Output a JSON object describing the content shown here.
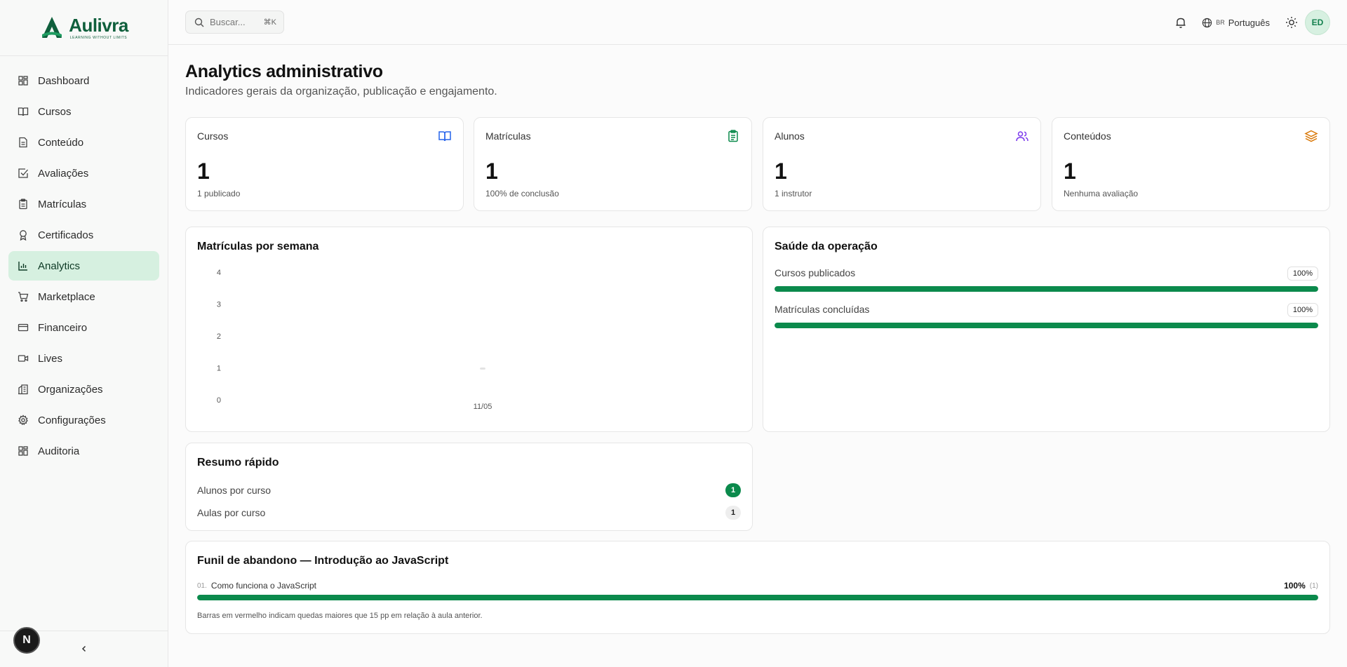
{
  "brand": {
    "name": "Aulivra",
    "tagline": "LEARNING WITHOUT LIMITS",
    "color": "#0f5f3c"
  },
  "sidebar": {
    "items": [
      {
        "label": "Dashboard",
        "icon": "grid-icon"
      },
      {
        "label": "Cursos",
        "icon": "book-open-icon"
      },
      {
        "label": "Conteúdo",
        "icon": "file-text-icon"
      },
      {
        "label": "Avaliações",
        "icon": "check-square-icon"
      },
      {
        "label": "Matrículas",
        "icon": "clipboard-icon"
      },
      {
        "label": "Certificados",
        "icon": "award-icon"
      },
      {
        "label": "Analytics",
        "icon": "bar-chart-icon",
        "active": true
      },
      {
        "label": "Marketplace",
        "icon": "shopping-cart-icon"
      },
      {
        "label": "Financeiro",
        "icon": "credit-card-icon"
      },
      {
        "label": "Lives",
        "icon": "video-icon"
      },
      {
        "label": "Organizações",
        "icon": "building-icon"
      },
      {
        "label": "Configurações",
        "icon": "settings-icon"
      },
      {
        "label": "Auditoria",
        "icon": "grid-icon"
      }
    ],
    "footer_badge": "N"
  },
  "topbar": {
    "search_placeholder": "Buscar...",
    "search_shortcut": "⌘K",
    "language_flag": "BR",
    "language": "Português",
    "avatar_initials": "ED"
  },
  "page": {
    "title": "Analytics administrativo",
    "subtitle": "Indicadores gerais da organização, publicação e engajamento."
  },
  "stats": [
    {
      "label": "Cursos",
      "value": "1",
      "sub": "1 publicado",
      "icon": "book-open-icon",
      "color": "#2563eb"
    },
    {
      "label": "Matrículas",
      "value": "1",
      "sub": "100% de conclusão",
      "icon": "clipboard-icon",
      "color": "#0b8a4c"
    },
    {
      "label": "Alunos",
      "value": "1",
      "sub": "1 instrutor",
      "icon": "users-icon",
      "color": "#7c3aed"
    },
    {
      "label": "Conteúdos",
      "value": "1",
      "sub": "Nenhuma avaliação",
      "icon": "layers-icon",
      "color": "#d97706"
    }
  ],
  "enrollments_chart": {
    "title": "Matrículas por semana"
  },
  "chart_data": {
    "type": "bar",
    "title": "Matrículas por semana",
    "categories": [
      "11/05"
    ],
    "values": [
      0
    ],
    "yticks": [
      "4",
      "3",
      "2",
      "1",
      "0"
    ],
    "ylim": [
      0,
      4
    ],
    "xlabel": "",
    "ylabel": "",
    "grid": false
  },
  "health": {
    "title": "Saúde da operação",
    "rows": [
      {
        "label": "Cursos publicados",
        "pct_label": "100%",
        "pct": 100
      },
      {
        "label": "Matrículas concluídas",
        "pct_label": "100%",
        "pct": 100
      }
    ]
  },
  "summary": {
    "title": "Resumo rápido",
    "rows": [
      {
        "label": "Alunos por curso",
        "value": "1"
      },
      {
        "label": "Aulas por curso",
        "value": "1"
      }
    ]
  },
  "funnel": {
    "title": "Funil de abandono — Introdução ao JavaScript",
    "lessons": [
      {
        "index": "01.",
        "name": "Como funciona o JavaScript",
        "pct_label": "100%",
        "count": "(1)",
        "pct": 100
      }
    ],
    "note": "Barras em vermelho indicam quedas maiores que 15 pp em relação à aula anterior."
  },
  "colors": {
    "accent": "#0b8a4c",
    "active_nav_bg": "#d6f0e0"
  }
}
